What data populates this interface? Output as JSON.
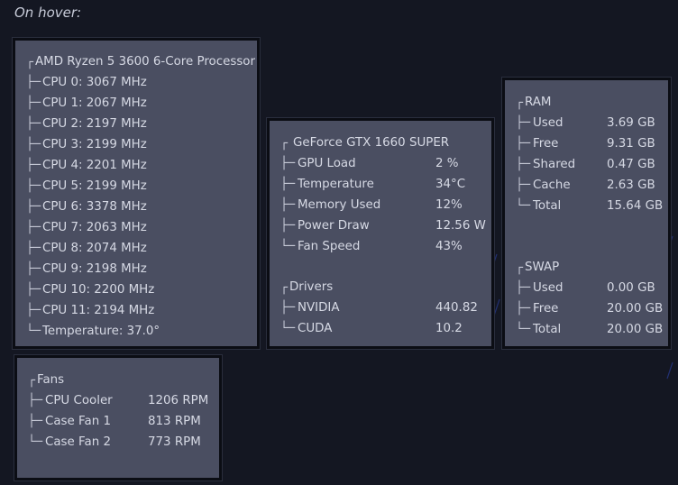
{
  "caption": "On hover:",
  "cpu": {
    "title": "AMD Ryzen 5 3600 6-Core Processor",
    "items": [
      {
        "prefix": "├─",
        "label": "CPU 0: 3067 MHz"
      },
      {
        "prefix": "├─",
        "label": "CPU 1: 2067 MHz"
      },
      {
        "prefix": "├─",
        "label": "CPU 2: 2197 MHz"
      },
      {
        "prefix": "├─",
        "label": "CPU 3: 2199 MHz"
      },
      {
        "prefix": "├─",
        "label": "CPU 4: 2201 MHz"
      },
      {
        "prefix": "├─",
        "label": "CPU 5: 2199 MHz"
      },
      {
        "prefix": "├─",
        "label": "CPU 6: 3378 MHz"
      },
      {
        "prefix": "├─",
        "label": "CPU 7: 2063 MHz"
      },
      {
        "prefix": "├─",
        "label": "CPU 8: 2074 MHz"
      },
      {
        "prefix": "├─",
        "label": "CPU 9: 2198 MHz"
      },
      {
        "prefix": "├─",
        "label": "CPU 10: 2200 MHz"
      },
      {
        "prefix": "├─",
        "label": "CPU 11: 2194 MHz"
      },
      {
        "prefix": "└─",
        "label": "Temperature: 37.0°"
      }
    ]
  },
  "gpu": {
    "title": "GeForce GTX 1660 SUPER",
    "items": [
      {
        "prefix": "├─",
        "label": "GPU Load",
        "value": "2 %"
      },
      {
        "prefix": "├─",
        "label": "Temperature",
        "value": "34°C"
      },
      {
        "prefix": "├─",
        "label": "Memory Used",
        "value": "12%"
      },
      {
        "prefix": "├─",
        "label": "Power Draw",
        "value": "12.56 W"
      },
      {
        "prefix": "└─",
        "label": "Fan Speed",
        "value": "43%"
      }
    ],
    "drivers_title": "Drivers",
    "drivers": [
      {
        "prefix": "├─",
        "label": "NVIDIA",
        "value": "440.82"
      },
      {
        "prefix": "└─",
        "label": "CUDA",
        "value": "10.2"
      }
    ]
  },
  "ram": {
    "title": "RAM",
    "items": [
      {
        "prefix": "├─",
        "label": "Used",
        "value": "3.69 GB"
      },
      {
        "prefix": "├─",
        "label": "Free",
        "value": "9.31 GB"
      },
      {
        "prefix": "├─",
        "label": "Shared",
        "value": "0.47 GB"
      },
      {
        "prefix": "├─",
        "label": "Cache",
        "value": "2.63 GB"
      },
      {
        "prefix": "└─",
        "label": "Total",
        "value": "15.64 GB"
      }
    ],
    "swap_title": "SWAP",
    "swap": [
      {
        "prefix": "├─",
        "label": "Used",
        "value": "0.00 GB"
      },
      {
        "prefix": "├─",
        "label": "Free",
        "value": "20.00 GB"
      },
      {
        "prefix": "└─",
        "label": "Total",
        "value": "20.00 GB"
      }
    ]
  },
  "fans": {
    "title": "Fans",
    "items": [
      {
        "prefix": "├─",
        "label": "CPU Cooler",
        "value": "1206 RPM"
      },
      {
        "prefix": "├─",
        "label": "Case Fan 1",
        "value": "813 RPM"
      },
      {
        "prefix": "└─",
        "label": "Case Fan 2",
        "value": "773 RPM"
      }
    ]
  },
  "branch_glyph": "┌",
  "colors": {
    "background": "#141722",
    "panel": "#4a4e61",
    "text": "#d6d9e4"
  }
}
